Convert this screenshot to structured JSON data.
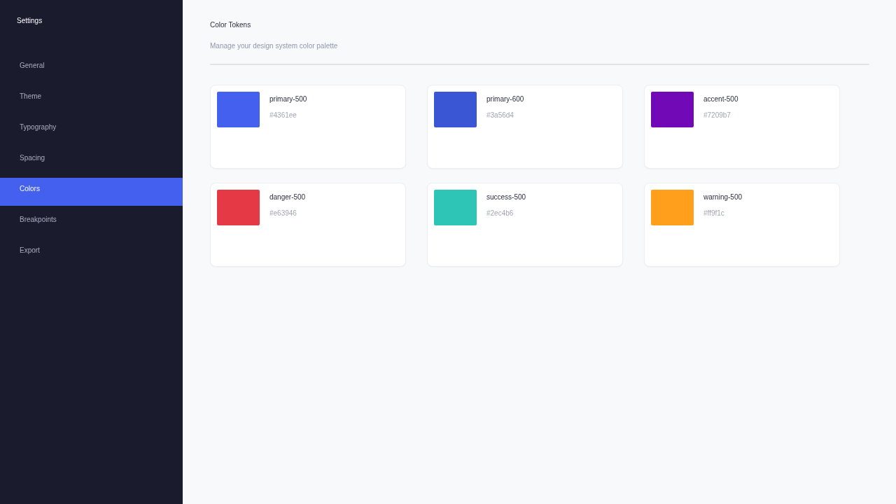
{
  "sidebar": {
    "title": "Settings",
    "items": [
      {
        "label": "General",
        "selected": false
      },
      {
        "label": "Theme",
        "selected": false
      },
      {
        "label": "Typography",
        "selected": false
      },
      {
        "label": "Spacing",
        "selected": false
      },
      {
        "label": "Colors",
        "selected": true
      },
      {
        "label": "Breakpoints",
        "selected": false
      },
      {
        "label": "Export",
        "selected": false
      }
    ]
  },
  "header": {
    "title": "Color Tokens",
    "subtitle": "Manage your design system color palette"
  },
  "tokens": [
    {
      "name": "primary-500",
      "hex": "#4361ee",
      "color": "#4361ee"
    },
    {
      "name": "primary-600",
      "hex": "#3a56d4",
      "color": "#3a56d4"
    },
    {
      "name": "accent-500",
      "hex": "#7209b7",
      "color": "#7209b7"
    },
    {
      "name": "danger-500",
      "hex": "#e63946",
      "color": "#e63946"
    },
    {
      "name": "success-500",
      "hex": "#2ec4b6",
      "color": "#2ec4b6"
    },
    {
      "name": "warning-500",
      "hex": "#ff9f1c",
      "color": "#ff9f1c"
    }
  ]
}
